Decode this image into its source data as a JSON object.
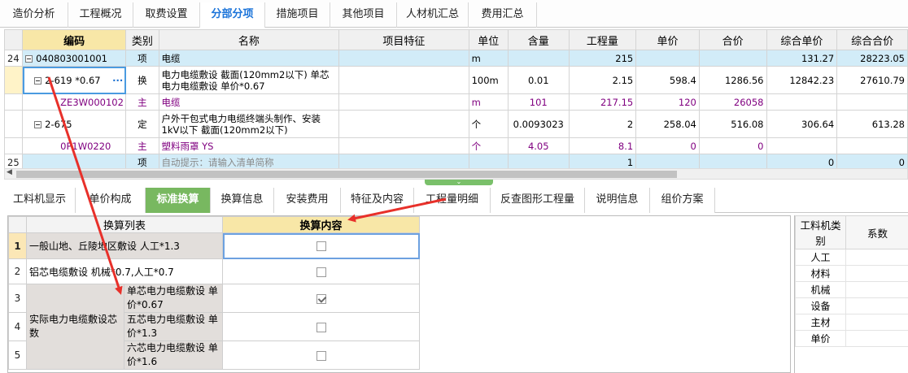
{
  "top_tabs": [
    "造价分析",
    "工程概况",
    "取费设置",
    "分部分项",
    "措施项目",
    "其他项目",
    "人材机汇总",
    "费用汇总"
  ],
  "top_active": "分部分项",
  "grid": {
    "headers": [
      "",
      "编码",
      "类别",
      "名称",
      "项目特征",
      "单位",
      "含量",
      "工程量",
      "单价",
      "合价",
      "综合单价",
      "综合合价"
    ],
    "rows": [
      {
        "num": "24",
        "code": "040803001001",
        "type": "项",
        "name": "电缆",
        "feature": "",
        "unit": "m",
        "content": "",
        "qty": "215",
        "price": "",
        "total": "",
        "comp_price": "131.27",
        "comp_total": "28223.05"
      },
      {
        "num": "",
        "code": "2-619 *0.67",
        "type": "换",
        "name": "电力电缆敷设 截面(120mm2以下) 单芯电力电缆敷设 单价*0.67",
        "feature": "",
        "unit": "100m",
        "content": "0.01",
        "qty": "2.15",
        "price": "598.4",
        "total": "1286.56",
        "comp_price": "12842.23",
        "comp_total": "27610.79"
      },
      {
        "num": "",
        "code": "ZE3W000102",
        "type": "主",
        "name": "电缆",
        "feature": "",
        "unit": "m",
        "content": "101",
        "qty": "217.15",
        "price": "120",
        "total": "26058",
        "comp_price": "",
        "comp_total": ""
      },
      {
        "num": "",
        "code": "2-675",
        "type": "定",
        "name": "户外干包式电力电缆终端头制作、安装 1kV以下 截面(120mm2以下)",
        "feature": "",
        "unit": "个",
        "content": "0.0093023",
        "qty": "2",
        "price": "258.04",
        "total": "516.08",
        "comp_price": "306.64",
        "comp_total": "613.28"
      },
      {
        "num": "",
        "code": "0P1W0220",
        "type": "主",
        "name": "塑料雨罩 YS",
        "feature": "",
        "unit": "个",
        "content": "4.05",
        "qty": "8.1",
        "price": "0",
        "total": "0",
        "comp_price": "",
        "comp_total": ""
      },
      {
        "num": "25",
        "code": "",
        "type": "项",
        "name": "自动提示：请输入清单简称",
        "feature": "",
        "unit": "",
        "content": "",
        "qty": "1",
        "price": "",
        "total": "",
        "comp_price": "0",
        "comp_total": "0"
      }
    ]
  },
  "bottom_tabs": [
    "工料机显示",
    "单价构成",
    "标准换算",
    "换算信息",
    "安装费用",
    "特征及内容",
    "工程量明细",
    "反查图形工程量",
    "说明信息",
    "组价方案"
  ],
  "bottom_active": "标准换算",
  "conversion": {
    "headers": [
      "换算列表",
      "换算内容"
    ],
    "rows": [
      {
        "num": "1",
        "label": "一般山地、丘陵地区敷设 人工*1.3",
        "checked": false
      },
      {
        "num": "2",
        "label": "铝芯电缆敷设 机械*0.7,人工*0.7",
        "checked": false
      },
      {
        "num": "3",
        "sub": "单芯电力电缆敷设 单价*0.67",
        "checked": true
      },
      {
        "num": "4",
        "sub": "五芯电力电缆敷设 单价*1.3",
        "checked": false
      },
      {
        "num": "5",
        "sub": "六芯电力电缆敷设 单价*1.6",
        "checked": false
      }
    ],
    "group_label": "实际电力电缆敷设芯数"
  },
  "side_panel": {
    "headers": [
      "工料机类别",
      "系数"
    ],
    "rows": [
      "人工",
      "材料",
      "机械",
      "设备",
      "主材",
      "单价"
    ]
  },
  "colors": {
    "active_top_tab": "#1a73d9",
    "active_bottom_tab": "#78b860",
    "row_highlight": "#d2ecf8",
    "header_highlight": "#f8e7a7",
    "arrow": "#e8302a"
  }
}
